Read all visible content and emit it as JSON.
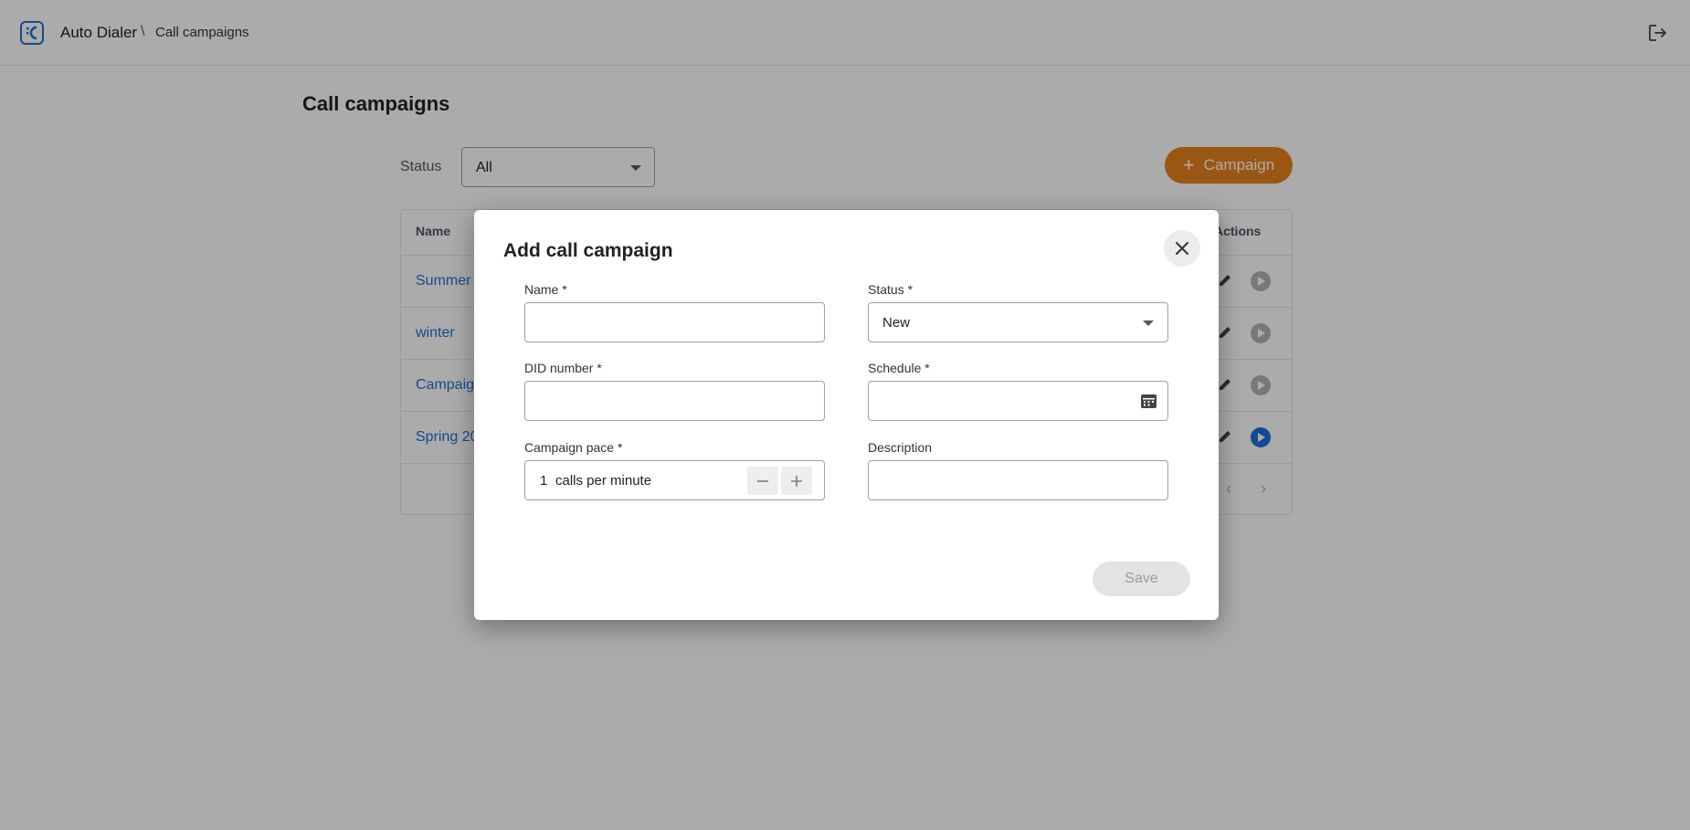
{
  "header": {
    "app_name": "Auto Dialer",
    "separator": "\\",
    "breadcrumb": "Call campaigns"
  },
  "page": {
    "title": "Call campaigns",
    "status_filter_label": "Status",
    "status_filter_value": "All",
    "add_button_label": "Campaign"
  },
  "table": {
    "columns": [
      "Name",
      "Actions"
    ],
    "rows": [
      {
        "name": "Summer 2",
        "running": false
      },
      {
        "name": "winter",
        "running": false
      },
      {
        "name": "Campaign",
        "running": false
      },
      {
        "name": "Spring 20",
        "running": true
      }
    ]
  },
  "dialog": {
    "title": "Add call campaign",
    "name_label": "Name *",
    "name_value": "",
    "status_label": "Status *",
    "status_value": "New",
    "did_label": "DID number *",
    "did_value": "",
    "schedule_label": "Schedule *",
    "schedule_value": "",
    "pace_label": "Campaign pace *",
    "pace_value": "1",
    "pace_unit": "calls per minute",
    "description_label": "Description",
    "description_value": "",
    "save_label": "Save"
  },
  "colors": {
    "accent": "#1e6fd9",
    "primary_button": "#e8801f"
  }
}
